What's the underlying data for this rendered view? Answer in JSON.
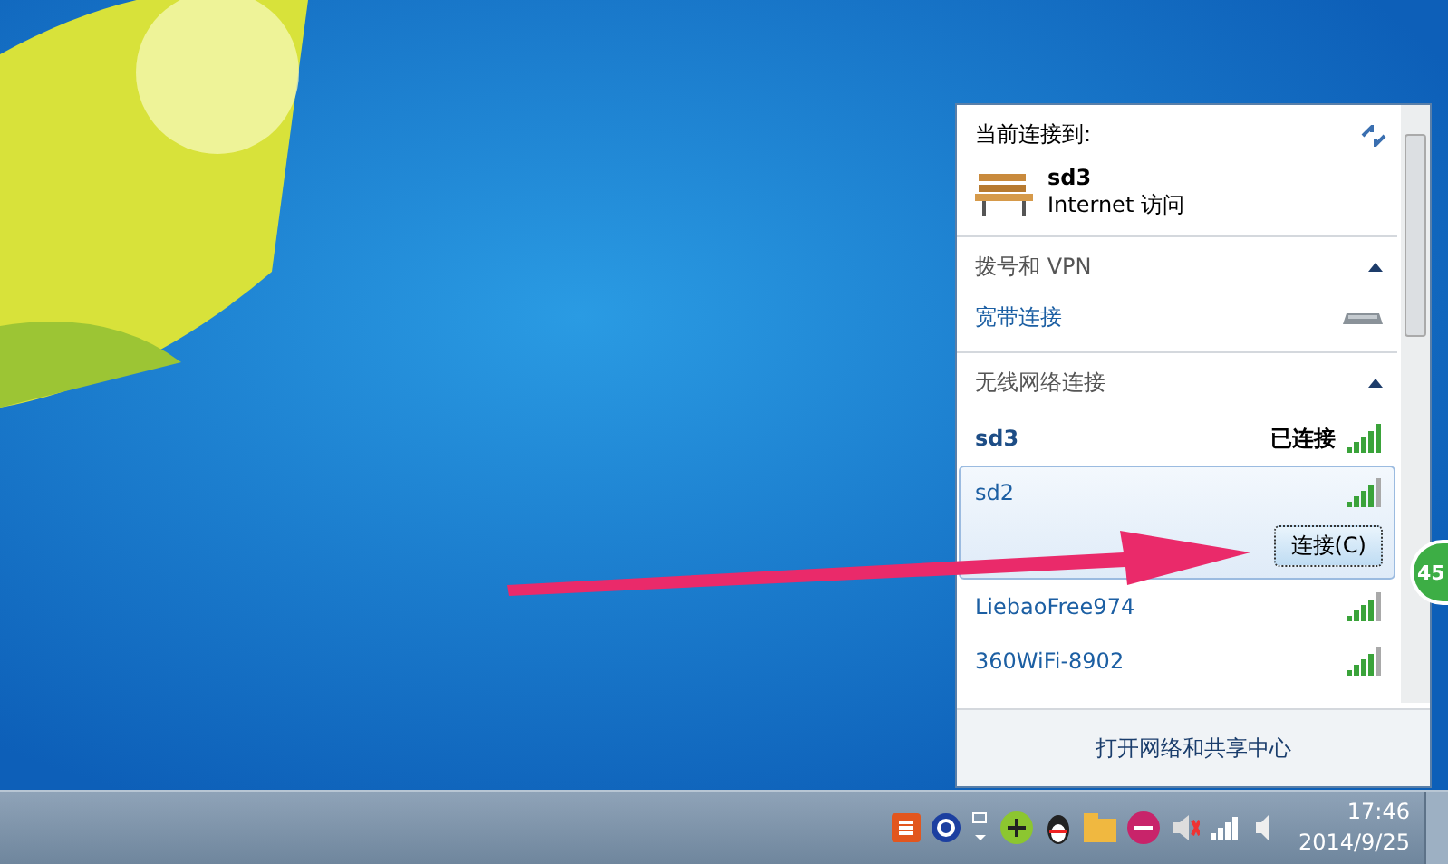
{
  "popup": {
    "header": "当前连接到:",
    "current": {
      "name": "sd3",
      "access": "Internet 访问"
    },
    "dialup": {
      "title": "拨号和 VPN",
      "expanded": true,
      "items": [
        {
          "name": "宽带连接"
        }
      ]
    },
    "wireless": {
      "title": "无线网络连接",
      "expanded": true,
      "networks": [
        {
          "name": "sd3",
          "connected": true,
          "status": "已连接",
          "selected": false
        },
        {
          "name": "sd2",
          "connected": false,
          "selected": true,
          "button": "连接(C)"
        },
        {
          "name": "LiebaoFree974",
          "connected": false,
          "selected": false
        },
        {
          "name": "360WiFi-8902",
          "connected": false,
          "selected": false
        }
      ]
    },
    "footer": "打开网络和共享中心"
  },
  "speed_badge": "45",
  "taskbar": {
    "time": "17:46",
    "date": "2014/9/25"
  }
}
